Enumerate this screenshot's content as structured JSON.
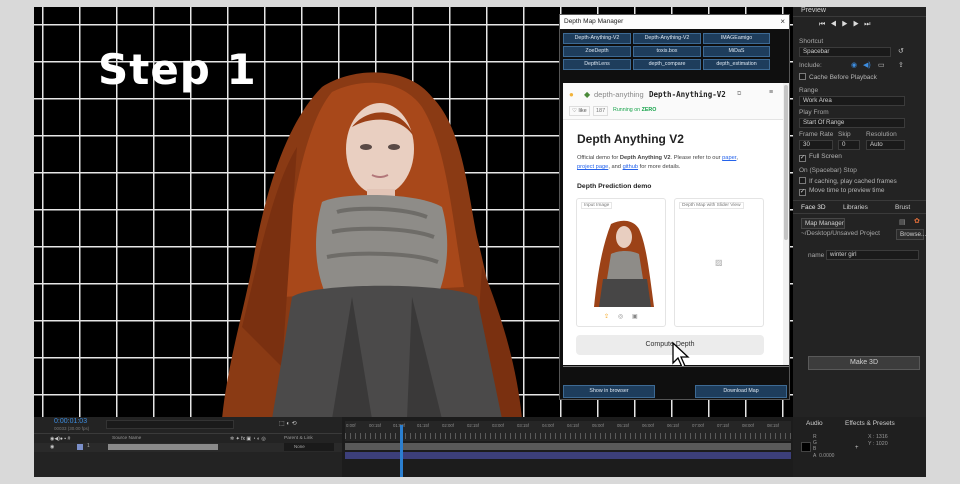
{
  "composition": {
    "overlay_title": "Step 1"
  },
  "preview_panel": {
    "title": "Preview",
    "shortcut_label": "Shortcut",
    "shortcut_value": "Spacebar",
    "include_label": "Include:",
    "cache_before_playback": "Cache Before Playback",
    "range_label": "Range",
    "range_value": "Work Area",
    "play_from_label": "Play From",
    "play_from_value": "Start Of Range",
    "frame_rate_label": "Frame Rate",
    "skip_label": "Skip",
    "resolution_label": "Resolution",
    "frame_rate_value": "30",
    "skip_value": "0",
    "resolution_value": "Auto",
    "full_screen": "Full Screen",
    "on_stop_label": "On (Spacebar) Stop",
    "if_caching": "If caching, play cached frames",
    "move_time": "Move time to preview time"
  },
  "face3d_panel": {
    "tabs": [
      "Face 3D",
      "Libraries",
      "Brust"
    ],
    "map_manager": "Map Manager",
    "project_path": "~/Desktop/Unsaved Project",
    "browse": "Browse...",
    "name_label": "name",
    "name_value": "winter girl",
    "make_3d": "Make 3D"
  },
  "dialog": {
    "title": "Depth Map Manager",
    "close": "×",
    "model_buttons": [
      "Depth-Anything-V2",
      "Depth-Anything-V2",
      "IMAGEamigo",
      "ZoeDepth",
      "toxis.box",
      "MiDaS",
      "DepthLens",
      "depth_compare",
      "depth_estimation"
    ],
    "space_owner": "depth-anything",
    "space_name": "Depth-Anything-V2",
    "like_label": "like",
    "like_count": "187",
    "running_on": "Running on",
    "running_hw": "ZERO",
    "page_title": "Depth Anything V2",
    "desc_1": "Official demo for",
    "desc_bold": "Depth Anything V2",
    "desc_2": ". Please refer to our",
    "link_paper": "paper",
    "link_project": "project page",
    "desc_3": ", and",
    "link_github": "github",
    "desc_4": "for more details.",
    "section": "Depth Prediction demo",
    "input_label": "Input Image",
    "output_label": "Depth Map with Slider View",
    "compute_button": "Compute Depth",
    "show_in_browser": "Show in browser",
    "download_map": "Download Map"
  },
  "timeline": {
    "timecode": "0:00:01:03",
    "fps_info": "00033 (30.00 fps)",
    "source_name_header": "Source Name",
    "parent_link_header": "Parent & Link",
    "parent_value": "None",
    "layer_number": "1",
    "ruler_labels": [
      "0:00f",
      "00:15f",
      "01:00f",
      "01:15f",
      "02:00f",
      "02:15f",
      "03:00f",
      "03:15f",
      "04:00f",
      "04:15f",
      "05:00f",
      "05:15f",
      "06:00f",
      "06:15f",
      "07:00f",
      "07:15f",
      "08:00f",
      "08:15f"
    ]
  },
  "info_panel": {
    "tabs": [
      "Audio",
      "Effects & Presets"
    ],
    "r": "R",
    "g": "G",
    "b": "B",
    "a": "A",
    "a_value": "0.0000",
    "x_label": "X",
    "x_value": "1316",
    "y_label": "Y",
    "y_value": "1020"
  },
  "colors": {
    "accent": "#2b7fd0",
    "dialog_button": "#1e3d5c",
    "running_green": "#16a34a",
    "link_blue": "#2563eb"
  }
}
